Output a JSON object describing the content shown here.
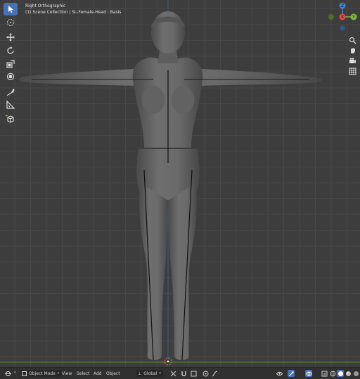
{
  "viewport": {
    "view_name": "Right Orthographic",
    "collection_path": "(1) Scene Collection | SL-Female-Head : Basis"
  },
  "toolbar": {
    "tools": [
      "select-box",
      "cursor",
      "move",
      "rotate",
      "scale",
      "transform",
      "annotate",
      "measure",
      "add-cube"
    ],
    "active": "select-box"
  },
  "gizmo": {
    "axes": {
      "z": "Z",
      "y": "Y",
      "x": "X"
    },
    "colors": {
      "x": "#e74c4c",
      "y": "#7fb83c",
      "z": "#3d85c6"
    }
  },
  "header": {
    "mode": "Object Mode",
    "menus": [
      "View",
      "Select",
      "Add",
      "Object"
    ],
    "transform_orientation": "Global"
  },
  "colors": {
    "accent": "#4772b3",
    "viewport_bg": "#3d3d3d",
    "grid": "#474747",
    "ground_line": "#5a8a2e"
  }
}
